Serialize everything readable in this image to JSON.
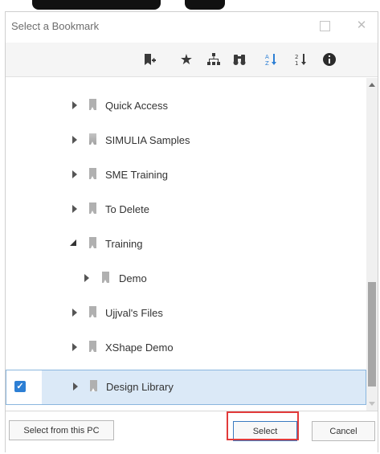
{
  "dialog": {
    "title": "Select a Bookmark"
  },
  "toolbar": {
    "icons": [
      "add-bookmark-icon",
      "favorite-star-icon",
      "hierarchy-icon",
      "binoculars-search-icon",
      "sort-az-icon",
      "sort-numeric-icon",
      "info-icon"
    ]
  },
  "tree": {
    "items": [
      {
        "label": "Quick Access"
      },
      {
        "label": "SIMULIA Samples"
      },
      {
        "label": "SME Training"
      },
      {
        "label": "To Delete"
      },
      {
        "label": "Training"
      },
      {
        "label": "Demo"
      },
      {
        "label": "Ujjval's Files"
      },
      {
        "label": "XShape Demo"
      },
      {
        "label": "Design Library"
      }
    ]
  },
  "footer": {
    "select_from_pc": "Select from this PC",
    "select": "Select",
    "cancel": "Cancel"
  },
  "colors": {
    "selection_bg": "#dbe9f7",
    "selection_border": "#8ab6de",
    "checkbox": "#2d7fd4",
    "highlight": "#e23a3a"
  }
}
